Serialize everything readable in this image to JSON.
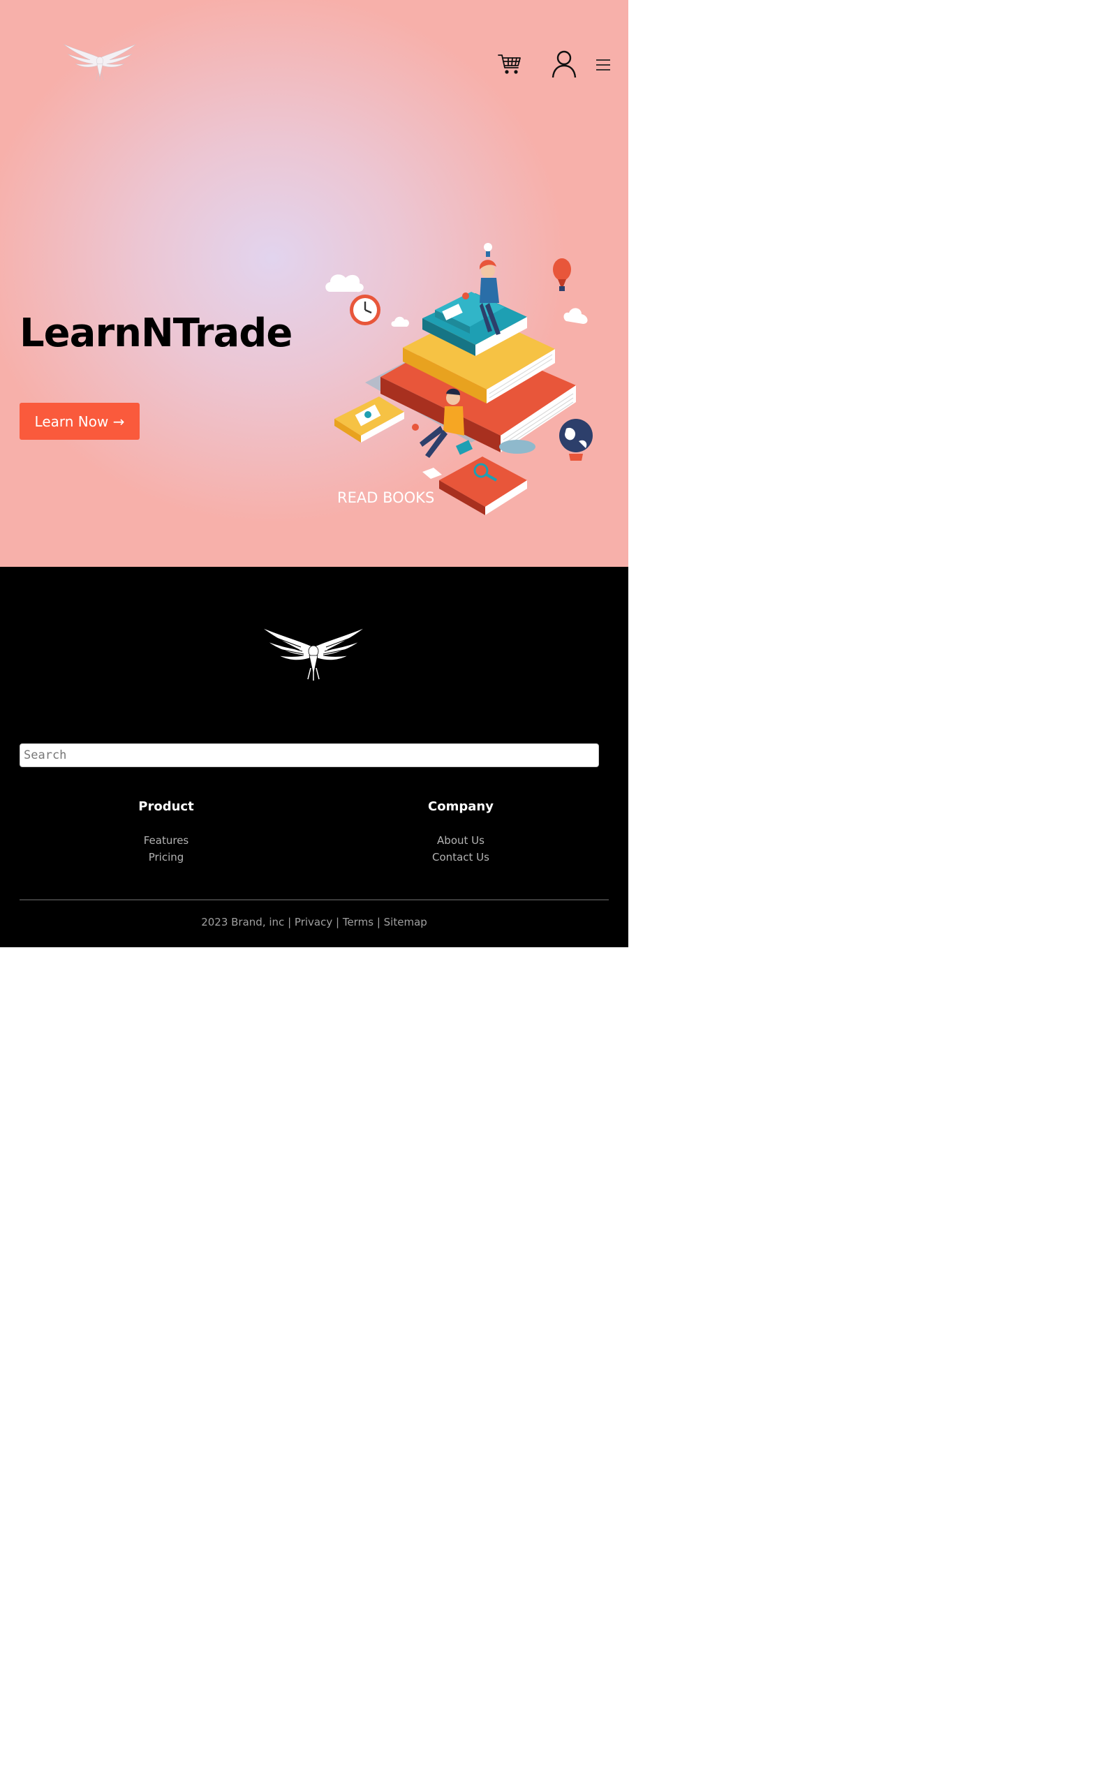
{
  "header": {
    "logo_icon": "eagle-logo-icon",
    "cart_icon": "shopping-cart-icon",
    "account_icon": "user-icon",
    "menu_icon": "hamburger-menu-icon"
  },
  "hero": {
    "title": "LearnNTrade",
    "cta_label": "Learn Now →",
    "illustration_caption": "READ BOOKS"
  },
  "footer": {
    "logo_icon": "eagle-logo-icon",
    "search_placeholder": "Search",
    "product": {
      "title": "Product",
      "links": [
        "Features",
        "Pricing"
      ]
    },
    "company": {
      "title": "Company",
      "links": [
        "About Us",
        "Contact Us"
      ]
    },
    "copyright": "2023 Brand, inc",
    "separator": "|",
    "legal_links": [
      "Privacy",
      "Terms",
      "Sitemap"
    ]
  },
  "colors": {
    "accent": "#fa5a3c",
    "hero_gradient_center": "#e2d4ee",
    "hero_gradient_edge": "#f7b0aa",
    "footer_bg": "#000000"
  }
}
